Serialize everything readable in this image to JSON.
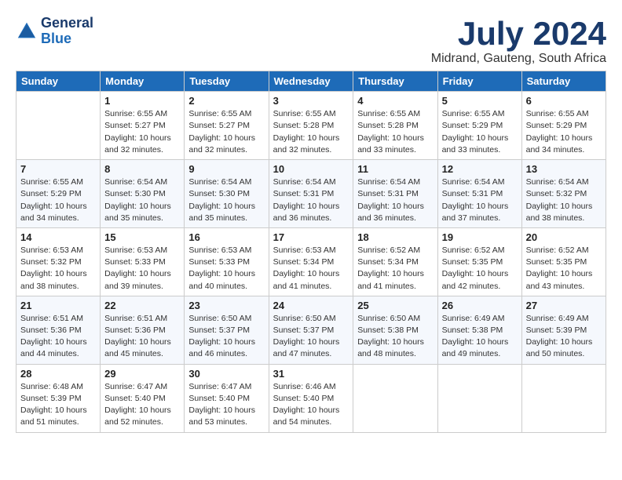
{
  "logo": {
    "text_general": "General",
    "text_blue": "Blue"
  },
  "title": "July 2024",
  "location": "Midrand, Gauteng, South Africa",
  "days_header": [
    "Sunday",
    "Monday",
    "Tuesday",
    "Wednesday",
    "Thursday",
    "Friday",
    "Saturday"
  ],
  "weeks": [
    [
      {
        "day": "",
        "info": ""
      },
      {
        "day": "1",
        "info": "Sunrise: 6:55 AM\nSunset: 5:27 PM\nDaylight: 10 hours\nand 32 minutes."
      },
      {
        "day": "2",
        "info": "Sunrise: 6:55 AM\nSunset: 5:27 PM\nDaylight: 10 hours\nand 32 minutes."
      },
      {
        "day": "3",
        "info": "Sunrise: 6:55 AM\nSunset: 5:28 PM\nDaylight: 10 hours\nand 32 minutes."
      },
      {
        "day": "4",
        "info": "Sunrise: 6:55 AM\nSunset: 5:28 PM\nDaylight: 10 hours\nand 33 minutes."
      },
      {
        "day": "5",
        "info": "Sunrise: 6:55 AM\nSunset: 5:29 PM\nDaylight: 10 hours\nand 33 minutes."
      },
      {
        "day": "6",
        "info": "Sunrise: 6:55 AM\nSunset: 5:29 PM\nDaylight: 10 hours\nand 34 minutes."
      }
    ],
    [
      {
        "day": "7",
        "info": "Sunrise: 6:55 AM\nSunset: 5:29 PM\nDaylight: 10 hours\nand 34 minutes."
      },
      {
        "day": "8",
        "info": "Sunrise: 6:54 AM\nSunset: 5:30 PM\nDaylight: 10 hours\nand 35 minutes."
      },
      {
        "day": "9",
        "info": "Sunrise: 6:54 AM\nSunset: 5:30 PM\nDaylight: 10 hours\nand 35 minutes."
      },
      {
        "day": "10",
        "info": "Sunrise: 6:54 AM\nSunset: 5:31 PM\nDaylight: 10 hours\nand 36 minutes."
      },
      {
        "day": "11",
        "info": "Sunrise: 6:54 AM\nSunset: 5:31 PM\nDaylight: 10 hours\nand 36 minutes."
      },
      {
        "day": "12",
        "info": "Sunrise: 6:54 AM\nSunset: 5:31 PM\nDaylight: 10 hours\nand 37 minutes."
      },
      {
        "day": "13",
        "info": "Sunrise: 6:54 AM\nSunset: 5:32 PM\nDaylight: 10 hours\nand 38 minutes."
      }
    ],
    [
      {
        "day": "14",
        "info": "Sunrise: 6:53 AM\nSunset: 5:32 PM\nDaylight: 10 hours\nand 38 minutes."
      },
      {
        "day": "15",
        "info": "Sunrise: 6:53 AM\nSunset: 5:33 PM\nDaylight: 10 hours\nand 39 minutes."
      },
      {
        "day": "16",
        "info": "Sunrise: 6:53 AM\nSunset: 5:33 PM\nDaylight: 10 hours\nand 40 minutes."
      },
      {
        "day": "17",
        "info": "Sunrise: 6:53 AM\nSunset: 5:34 PM\nDaylight: 10 hours\nand 41 minutes."
      },
      {
        "day": "18",
        "info": "Sunrise: 6:52 AM\nSunset: 5:34 PM\nDaylight: 10 hours\nand 41 minutes."
      },
      {
        "day": "19",
        "info": "Sunrise: 6:52 AM\nSunset: 5:35 PM\nDaylight: 10 hours\nand 42 minutes."
      },
      {
        "day": "20",
        "info": "Sunrise: 6:52 AM\nSunset: 5:35 PM\nDaylight: 10 hours\nand 43 minutes."
      }
    ],
    [
      {
        "day": "21",
        "info": "Sunrise: 6:51 AM\nSunset: 5:36 PM\nDaylight: 10 hours\nand 44 minutes."
      },
      {
        "day": "22",
        "info": "Sunrise: 6:51 AM\nSunset: 5:36 PM\nDaylight: 10 hours\nand 45 minutes."
      },
      {
        "day": "23",
        "info": "Sunrise: 6:50 AM\nSunset: 5:37 PM\nDaylight: 10 hours\nand 46 minutes."
      },
      {
        "day": "24",
        "info": "Sunrise: 6:50 AM\nSunset: 5:37 PM\nDaylight: 10 hours\nand 47 minutes."
      },
      {
        "day": "25",
        "info": "Sunrise: 6:50 AM\nSunset: 5:38 PM\nDaylight: 10 hours\nand 48 minutes."
      },
      {
        "day": "26",
        "info": "Sunrise: 6:49 AM\nSunset: 5:38 PM\nDaylight: 10 hours\nand 49 minutes."
      },
      {
        "day": "27",
        "info": "Sunrise: 6:49 AM\nSunset: 5:39 PM\nDaylight: 10 hours\nand 50 minutes."
      }
    ],
    [
      {
        "day": "28",
        "info": "Sunrise: 6:48 AM\nSunset: 5:39 PM\nDaylight: 10 hours\nand 51 minutes."
      },
      {
        "day": "29",
        "info": "Sunrise: 6:47 AM\nSunset: 5:40 PM\nDaylight: 10 hours\nand 52 minutes."
      },
      {
        "day": "30",
        "info": "Sunrise: 6:47 AM\nSunset: 5:40 PM\nDaylight: 10 hours\nand 53 minutes."
      },
      {
        "day": "31",
        "info": "Sunrise: 6:46 AM\nSunset: 5:40 PM\nDaylight: 10 hours\nand 54 minutes."
      },
      {
        "day": "",
        "info": ""
      },
      {
        "day": "",
        "info": ""
      },
      {
        "day": "",
        "info": ""
      }
    ]
  ]
}
